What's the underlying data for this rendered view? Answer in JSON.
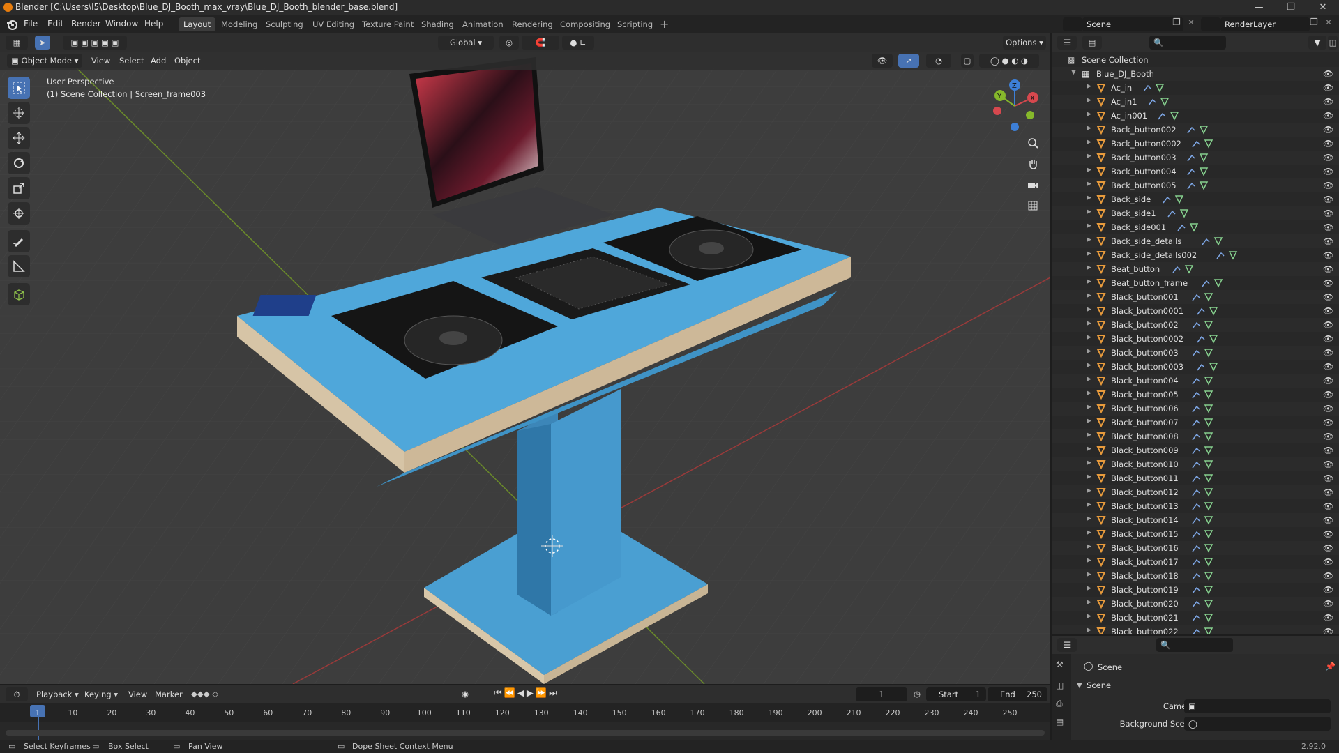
{
  "window": {
    "title": "Blender [C:\\Users\\I5\\Desktop\\Blue_DJ_Booth_max_vray\\Blue_DJ_Booth_blender_base.blend]"
  },
  "menu": [
    "File",
    "Edit",
    "Render",
    "Window",
    "Help"
  ],
  "workspaces": [
    "Layout",
    "Modeling",
    "Sculpting",
    "UV Editing",
    "Texture Paint",
    "Shading",
    "Animation",
    "Rendering",
    "Compositing",
    "Scripting"
  ],
  "scene_field": "Scene",
  "render_layer_field": "RenderLayer",
  "viewport": {
    "transform_orientation": "Global",
    "options_label": "Options",
    "mode": "Object Mode",
    "header_menus": [
      "View",
      "Select",
      "Add",
      "Object"
    ],
    "perspective_label": "User Perspective",
    "collection_label": "(1) Scene Collection | Screen_frame003",
    "gizmo_axes": {
      "x": "X",
      "y": "Y",
      "z": "Z"
    }
  },
  "outliner": {
    "root": "Scene Collection",
    "collection": "Blue_DJ_Booth",
    "items": [
      "Ac_in",
      "Ac_in1",
      "Ac_in001",
      "Back_button002",
      "Back_button0002",
      "Back_button003",
      "Back_button004",
      "Back_button005",
      "Back_side",
      "Back_side1",
      "Back_side001",
      "Back_side_details",
      "Back_side_details002",
      "Beat_button",
      "Beat_button_frame",
      "Black_button001",
      "Black_button0001",
      "Black_button002",
      "Black_button0002",
      "Black_button003",
      "Black_button0003",
      "Black_button004",
      "Black_button005",
      "Black_button006",
      "Black_button007",
      "Black_button008",
      "Black_button009",
      "Black_button010",
      "Black_button011",
      "Black_button012",
      "Black_button013",
      "Black_button014",
      "Black_button015",
      "Black_button016",
      "Black_button017",
      "Black_button018",
      "Black_button019",
      "Black_button020",
      "Black_button021",
      "Black_button022"
    ]
  },
  "properties": {
    "context": "Scene",
    "panel": "Scene",
    "camera_label": "Camera",
    "background_label": "Background Scene"
  },
  "timeline": {
    "menus": [
      "Playback",
      "Keying",
      "View",
      "Marker"
    ],
    "current_frame": "1",
    "start_label": "Start",
    "start_value": "1",
    "end_label": "End",
    "end_value": "250",
    "ticks": [
      "1",
      "10",
      "20",
      "30",
      "40",
      "50",
      "60",
      "70",
      "80",
      "90",
      "100",
      "110",
      "120",
      "130",
      "140",
      "150",
      "160",
      "170",
      "180",
      "190",
      "200",
      "210",
      "220",
      "230",
      "240",
      "250"
    ]
  },
  "statusbar": {
    "items": [
      "Select Keyframes",
      "Box Select",
      "Pan View",
      "Dope Sheet Context Menu"
    ],
    "version": "2.92.0"
  }
}
